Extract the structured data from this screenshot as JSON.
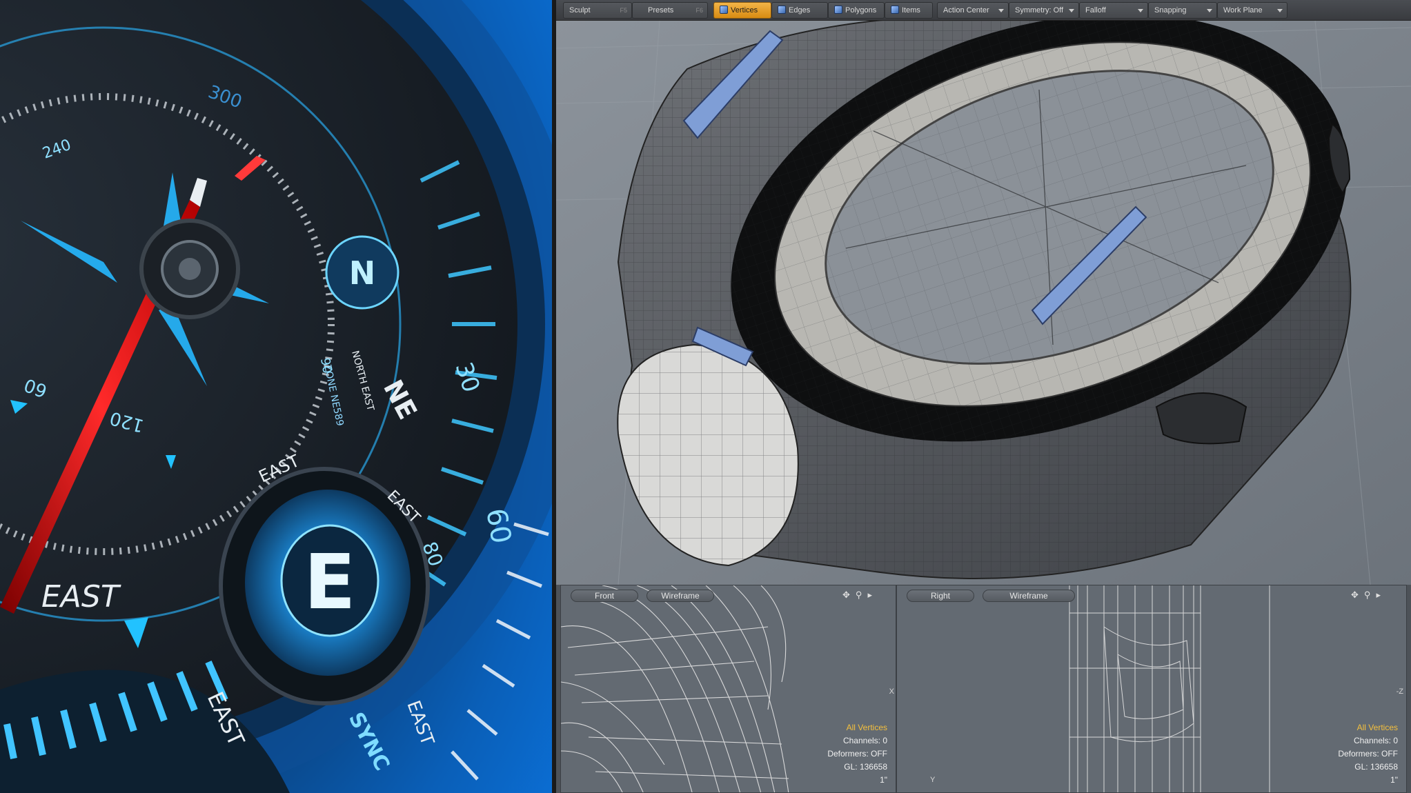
{
  "render": {
    "dial_labels": [
      "NE",
      "NORTH EAST",
      "ZONE NE589",
      "EAST",
      "EAST",
      "EAST",
      "EAST",
      "EAST",
      "SYNC",
      "60",
      "30",
      "80",
      "120",
      "240",
      "300",
      "60",
      "90"
    ],
    "center_letter": "E",
    "upper_letter": "N"
  },
  "toolbar": {
    "sculpt": {
      "label": "Sculpt",
      "key": "F5"
    },
    "presets": {
      "label": "Presets",
      "key": "F6"
    },
    "vertices": "Vertices",
    "edges": "Edges",
    "polygons": "Polygons",
    "items": "Items",
    "action_center": "Action Center",
    "symmetry": "Symmetry: Off",
    "falloff": "Falloff",
    "snapping": "Snapping",
    "work_plane": "Work Plane"
  },
  "views": {
    "front": {
      "name": "Front",
      "shading": "Wireframe",
      "stats": {
        "selection": "All Vertices",
        "channels": "Channels: 0",
        "deformers": "Deformers: OFF",
        "gl": "GL: 136658",
        "scale": "1\""
      },
      "axis_right": "X"
    },
    "right": {
      "name": "Right",
      "shading": "Wireframe",
      "stats": {
        "selection": "All Vertices",
        "channels": "Channels: 0",
        "deformers": "Deformers: OFF",
        "gl": "GL: 136658",
        "scale": "1\""
      },
      "axis_right": "-Z",
      "axis_y": "Y"
    }
  },
  "colors": {
    "accent_active": "#e8a020",
    "highlight_text": "#f5c03d",
    "render_blue": "#1a8fe0",
    "render_red": "#e02020"
  }
}
